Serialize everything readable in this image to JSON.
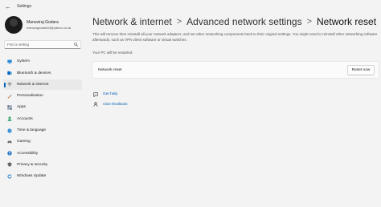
{
  "window": {
    "title": "Settings",
    "back_label": "←"
  },
  "profile": {
    "name": "Manuviraj Godara",
    "email": "manuvigodara94@yahoo.co.uk"
  },
  "search": {
    "placeholder": "Find a setting"
  },
  "sidebar": {
    "items": [
      {
        "label": "System",
        "icon": "monitor-icon",
        "color": "#2b88d8"
      },
      {
        "label": "Bluetooth & devices",
        "icon": "bluetooth-icon",
        "color": "#0067c0"
      },
      {
        "label": "Network & internet",
        "icon": "wifi-icon",
        "color": "#404040",
        "active": true
      },
      {
        "label": "Personalization",
        "icon": "brush-icon",
        "color": "#e0803a"
      },
      {
        "label": "Apps",
        "icon": "apps-icon",
        "color": "#5a6b82"
      },
      {
        "label": "Accounts",
        "icon": "person-icon",
        "color": "#2fa36b"
      },
      {
        "label": "Time & language",
        "icon": "globe-clock-icon",
        "color": "#2b88d8"
      },
      {
        "label": "Gaming",
        "icon": "controller-icon",
        "color": "#6b6b6b"
      },
      {
        "label": "Accessibility",
        "icon": "accessibility-icon",
        "color": "#1b6fc2"
      },
      {
        "label": "Privacy & security",
        "icon": "shield-icon",
        "color": "#6b6b6b"
      },
      {
        "label": "Windows Update",
        "icon": "update-icon",
        "color": "#0067c0"
      }
    ]
  },
  "breadcrumb": {
    "items": [
      "Network & internet",
      "Advanced network settings",
      "Network reset"
    ],
    "separator": ">"
  },
  "main": {
    "description": "This will remove then reinstall all your network adapters, and set other networking components back to their original settings. You might need to reinstall other networking software afterwards, such as VPN client software or virtual switches.",
    "restart_note": "Your PC will be restarted.",
    "card": {
      "label": "Network reset",
      "button_label": "Reset now"
    },
    "links": [
      {
        "label": "Get help",
        "icon": "help-chat-icon"
      },
      {
        "label": "Give feedback",
        "icon": "feedback-icon"
      }
    ]
  },
  "colors": {
    "accent": "#005fb8",
    "background": "#f3f3f3",
    "card": "#fbfbfb"
  }
}
